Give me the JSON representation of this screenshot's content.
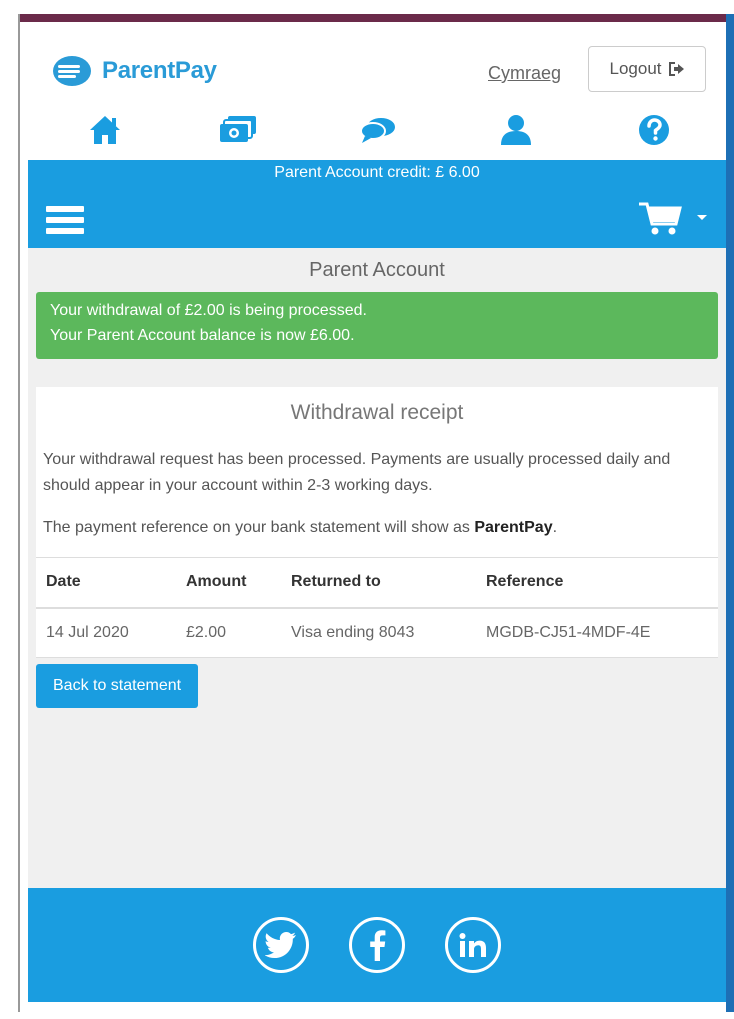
{
  "brand": {
    "name": "ParentPay"
  },
  "header": {
    "language_link": "Cymraeg",
    "logout_label": "Logout",
    "nav": [
      {
        "icon": "home-icon"
      },
      {
        "icon": "payments-icon"
      },
      {
        "icon": "messages-icon"
      },
      {
        "icon": "account-icon"
      },
      {
        "icon": "help-icon"
      }
    ]
  },
  "credit_bar": {
    "text": "Parent Account credit: £ 6.00"
  },
  "page": {
    "title": "Parent Account",
    "alert": {
      "line1": "Your withdrawal of £2.00 is being processed.",
      "line2": "Your Parent Account balance is now £6.00."
    },
    "receipt": {
      "title": "Withdrawal receipt",
      "paragraph1": "Your withdrawal request has been processed. Payments are usually processed daily and should appear in your account within 2-3 working days.",
      "paragraph2_prefix": "The payment reference on your bank statement will show as ",
      "paragraph2_bold": "ParentPay",
      "paragraph2_suffix": ".",
      "columns": [
        "Date",
        "Amount",
        "Returned to",
        "Reference"
      ],
      "rows": [
        [
          "14 Jul 2020",
          "£2.00",
          "Visa ending 8043",
          "MGDB-CJ51-4MDF-4E"
        ]
      ]
    },
    "back_button": "Back to statement"
  },
  "footer": {
    "social": [
      "twitter-icon",
      "facebook-icon",
      "linkedin-icon"
    ]
  },
  "colors": {
    "brand_blue": "#1a9de0",
    "success_green": "#5cb85c",
    "logo_blue": "#2a9bd7"
  }
}
